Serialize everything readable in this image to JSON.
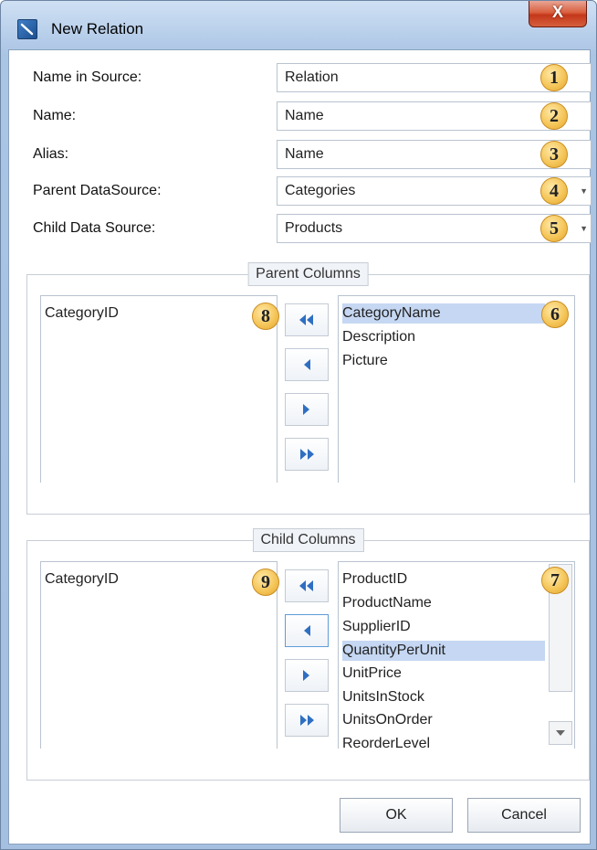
{
  "window": {
    "title": "New Relation",
    "close_glyph": "X"
  },
  "form": {
    "rows": [
      {
        "label": "Name in Source:",
        "value": "Relation",
        "badge": "1",
        "dropdown": false
      },
      {
        "label": "Name:",
        "value": "Name",
        "badge": "2",
        "dropdown": false
      },
      {
        "label": "Alias:",
        "value": "Name",
        "badge": "3",
        "dropdown": false
      },
      {
        "label": "Parent DataSource:",
        "value": "Categories",
        "badge": "4",
        "dropdown": true
      },
      {
        "label": "Child Data Source:",
        "value": "Products",
        "badge": "5",
        "dropdown": true
      }
    ]
  },
  "parent_columns": {
    "title": "Parent Columns",
    "left_items": [
      "CategoryID"
    ],
    "left_badge": "8",
    "right_items": [
      "CategoryName",
      "Description",
      "Picture"
    ],
    "right_selected": 0,
    "right_badge": "6"
  },
  "child_columns": {
    "title": "Child Columns",
    "left_items": [
      "CategoryID"
    ],
    "left_badge": "9",
    "right_items": [
      "ProductID",
      "ProductName",
      "SupplierID",
      "QuantityPerUnit",
      "UnitPrice",
      "UnitsInStock",
      "UnitsOnOrder",
      "ReorderLevel"
    ],
    "right_selected": 3,
    "right_badge": "7"
  },
  "icons": {
    "move_all_left": "double-left-arrow-icon",
    "move_left": "left-arrow-icon",
    "move_right": "right-arrow-icon",
    "move_all_right": "double-right-arrow-icon"
  },
  "colors": {
    "accent_arrow": "#2f6fc2",
    "selection": "#c5d7f2",
    "badge": "#f5c65a"
  },
  "buttons": {
    "ok": "OK",
    "cancel": "Cancel"
  }
}
